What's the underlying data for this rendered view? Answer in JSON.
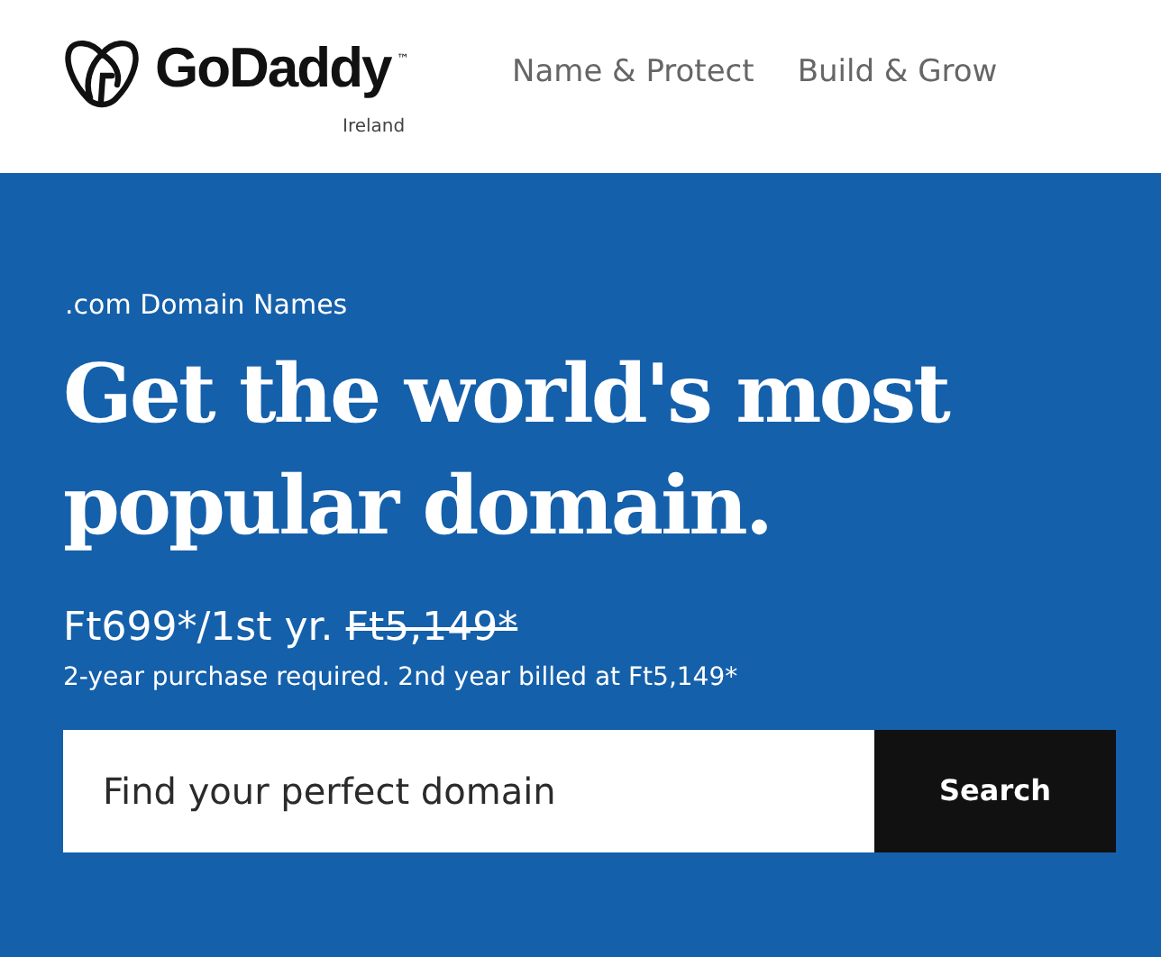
{
  "header": {
    "logo": {
      "wordmark": "GoDaddy",
      "trademark": "™",
      "region": "Ireland"
    },
    "nav": [
      {
        "label": "Name & Protect"
      },
      {
        "label": "Build & Grow"
      }
    ]
  },
  "hero": {
    "eyebrow": ".com Domain Names",
    "headline": "Get the world's most popular domain.",
    "price": "Ft699*/1st yr.",
    "old_price": "Ft5,149*",
    "note": "2-year purchase required. 2nd year billed at Ft5,149*",
    "search": {
      "placeholder": "Find your perfect domain",
      "button": "Search"
    }
  }
}
